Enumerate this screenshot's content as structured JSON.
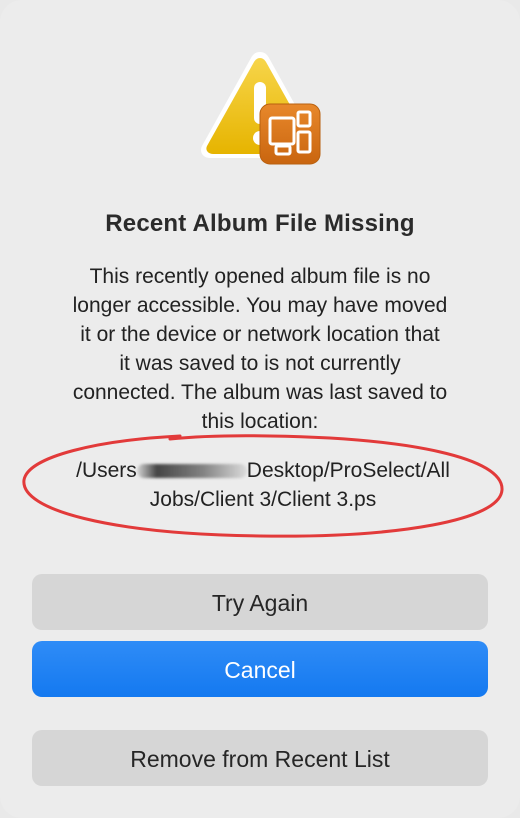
{
  "dialog": {
    "icon": "warning-triangle-icon with proselect-app-badge-icon",
    "title": "Recent Album File Missing",
    "message_lines": [
      "This recently opened album file is no",
      "longer accessible. You may have moved",
      "it or the device or network location that",
      "it was saved to is not currently",
      "connected. The album was last saved to",
      "this location:"
    ],
    "path": {
      "prefix": "/Users",
      "suffix_line1": "Desktop/ProSelect/All",
      "line2": "Jobs/Client 3/Client 3.ps"
    },
    "annotation_color": "#e23a3a"
  },
  "buttons": {
    "try_again": "Try Again",
    "cancel": "Cancel",
    "remove": "Remove from Recent List"
  },
  "colors": {
    "primary": "#1479f0",
    "secondary": "#d6d6d6",
    "warning": "#f2c200",
    "badge": "#d9781a"
  }
}
